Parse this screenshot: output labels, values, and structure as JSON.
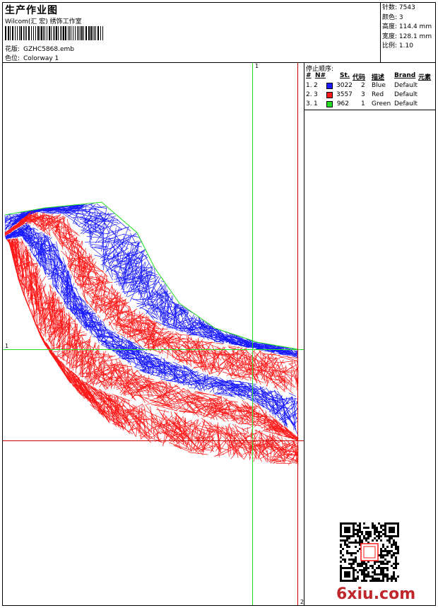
{
  "header": {
    "title": "生产作业图",
    "studio": "Wilcom(汇 宏) 绣饰工作室",
    "design_label": "花版:",
    "design_value": "GZHC5868.emb",
    "colorway_label": "色位:",
    "colorway_value": "Colorway 1"
  },
  "stats": [
    {
      "label": "针数:",
      "value": "7543"
    },
    {
      "label": "颜色:",
      "value": "3"
    },
    {
      "label": "高度:",
      "value": "114.4 mm"
    },
    {
      "label": "宽度:",
      "value": "128.1 mm"
    },
    {
      "label": "比例:",
      "value": "1.10"
    }
  ],
  "stop_sequence": {
    "title": "停止顺序:",
    "headers": {
      "num": "#",
      "n": "N#",
      "st": "St.",
      "code": "代码",
      "desc": "描述",
      "brand": "Brand",
      "element": "元素"
    },
    "rows": [
      {
        "num": "1.",
        "n": "2",
        "color": "#1a1aff",
        "st": "3022",
        "code": "2",
        "desc": "Blue",
        "brand": "Default"
      },
      {
        "num": "2.",
        "n": "3",
        "color": "#ff1a1a",
        "st": "3557",
        "code": "3",
        "desc": "Red",
        "brand": "Default"
      },
      {
        "num": "3.",
        "n": "1",
        "color": "#22dd22",
        "st": "962",
        "code": "1",
        "desc": "Green",
        "brand": "Default"
      }
    ]
  },
  "guides": {
    "top": "1",
    "left": "1",
    "bottom": "2"
  },
  "colors": {
    "blue": "#1a1aff",
    "red": "#ff1a1a",
    "green": "#22dd22",
    "guide_red": "#cc0000"
  },
  "watermark": {
    "text": "6xiu.com",
    "seal_icon": "qr-code-icon"
  }
}
